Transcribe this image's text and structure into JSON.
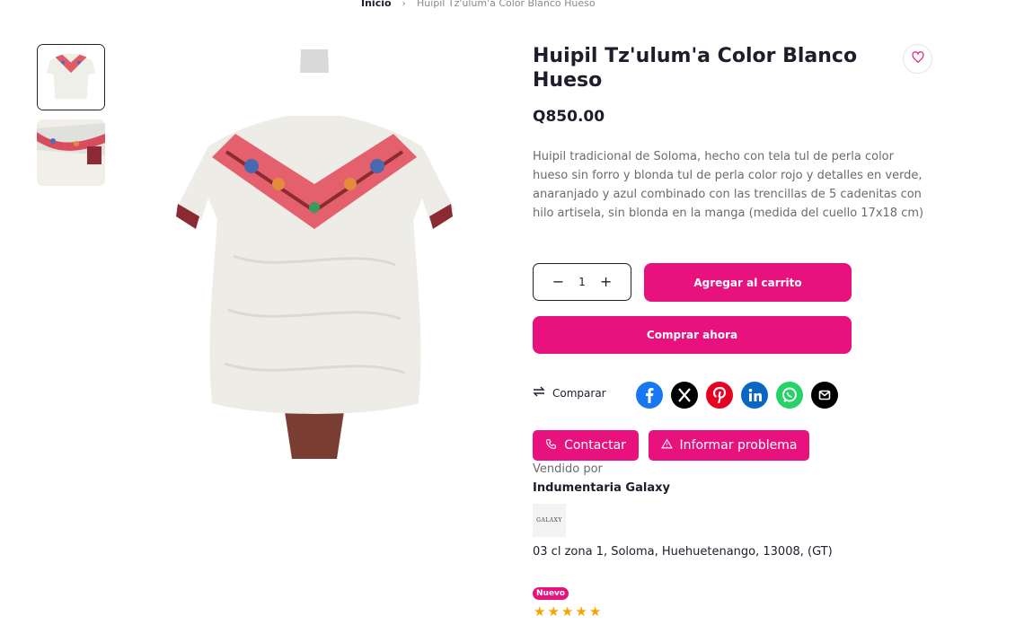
{
  "breadcrumb": {
    "home": "Inicio",
    "separator": "›",
    "current": "Huipil Tz'ulum'a Color Blanco Hueso"
  },
  "product": {
    "title": "Huipil Tz'ulum'a Color Blanco Hueso",
    "price": "Q850.00",
    "description": "Huipil tradicional de Soloma, hecho con tela tul de perla color hueso sin forro y blonda tul de perla color rojo y detalles en verde, anaranjado y azul combinado con las trencillas de 5 cadenitas con hilo artisela, sin blonda en la manga (medida del cuello 17x18 cm)"
  },
  "quantity": {
    "value": "1",
    "minus": "−",
    "plus": "+"
  },
  "buttons": {
    "add_to_cart": "Agregar al carrito",
    "buy_now": "Comprar ahora",
    "compare": "Comparar",
    "contact": "Contactar",
    "report": "Informar problema"
  },
  "social": [
    {
      "name": "facebook",
      "color": "#1877f2",
      "glyph": "f"
    },
    {
      "name": "x",
      "color": "#000000",
      "glyph": "𝕏"
    },
    {
      "name": "pinterest",
      "color": "#e60023",
      "glyph": "P"
    },
    {
      "name": "linkedin",
      "color": "#0a66c2",
      "glyph": "in"
    },
    {
      "name": "whatsapp",
      "color": "#25d366",
      "glyph": "✆"
    },
    {
      "name": "email",
      "color": "#000000",
      "glyph": "✉"
    }
  ],
  "vendor": {
    "sold_by_label": "Vendido por",
    "name": "Indumentaria Galaxy",
    "logo_text": "GALAXY",
    "address": "03 cl zona 1, Soloma, Huehuetenango, 13008, (GT)"
  },
  "badge": "Nuevo",
  "rating": {
    "stars": 5,
    "max": 5
  },
  "colors": {
    "accent": "#e8127f",
    "star": "#f2a700",
    "text": "#1d1d2b"
  }
}
